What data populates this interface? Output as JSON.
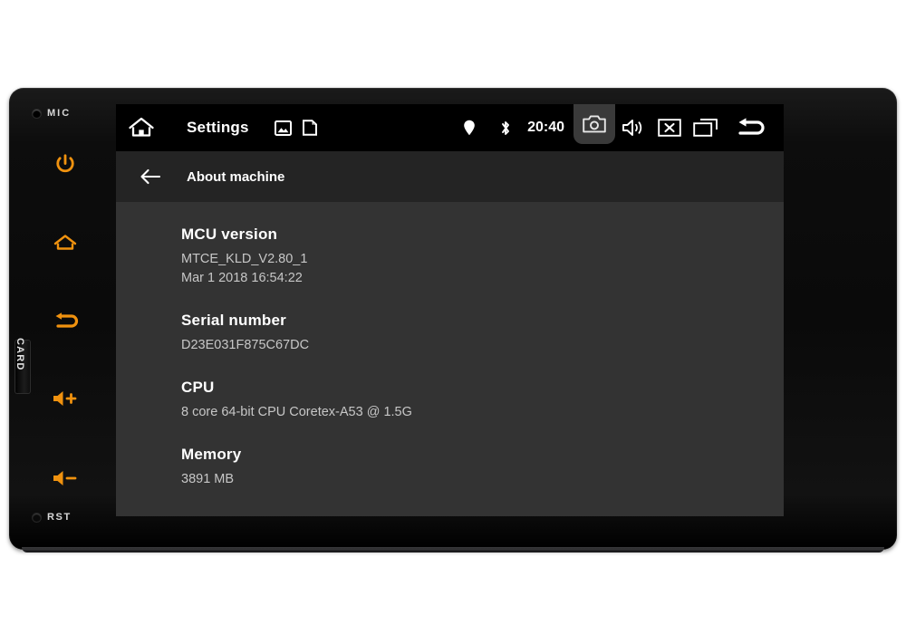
{
  "device": {
    "bezel": {
      "mic_label": "MIC",
      "rst_label": "RST",
      "card_label": "CARD",
      "buttons": [
        {
          "name": "power",
          "label": "Power"
        },
        {
          "name": "home",
          "label": "Home"
        },
        {
          "name": "back",
          "label": "Back"
        },
        {
          "name": "volume-up",
          "label": "Volume Up"
        },
        {
          "name": "volume-down",
          "label": "Volume Down"
        }
      ],
      "accent_color": "#f0920f"
    }
  },
  "statusbar": {
    "home_icon": "home-icon",
    "title": "Settings",
    "mini_icons": [
      "gallery-icon",
      "sd-card-icon"
    ],
    "location_icon": "location-pin-icon",
    "bluetooth_icon": "bluetooth-icon",
    "clock": "20:40",
    "right_icons": [
      {
        "name": "screenshot-camera-icon",
        "active": true
      },
      {
        "name": "volume-speaker-icon",
        "active": false
      },
      {
        "name": "close-x-icon",
        "active": false
      },
      {
        "name": "recent-apps-icon",
        "active": false
      },
      {
        "name": "back-return-icon",
        "active": false
      }
    ],
    "background_color": "#000000"
  },
  "subheader": {
    "back_icon": "arrow-left-icon",
    "title": "About machine",
    "background_color": "#242424"
  },
  "content": {
    "background_color": "#333333",
    "items": [
      {
        "label": "MCU version",
        "value": "MTCE_KLD_V2.80_1\nMar  1 2018 16:54:22"
      },
      {
        "label": "Serial number",
        "value": "D23E031F875C67DC"
      },
      {
        "label": "CPU",
        "value": "8 core 64-bit CPU Coretex-A53 @ 1.5G"
      },
      {
        "label": "Memory",
        "value": "3891 MB"
      }
    ]
  }
}
